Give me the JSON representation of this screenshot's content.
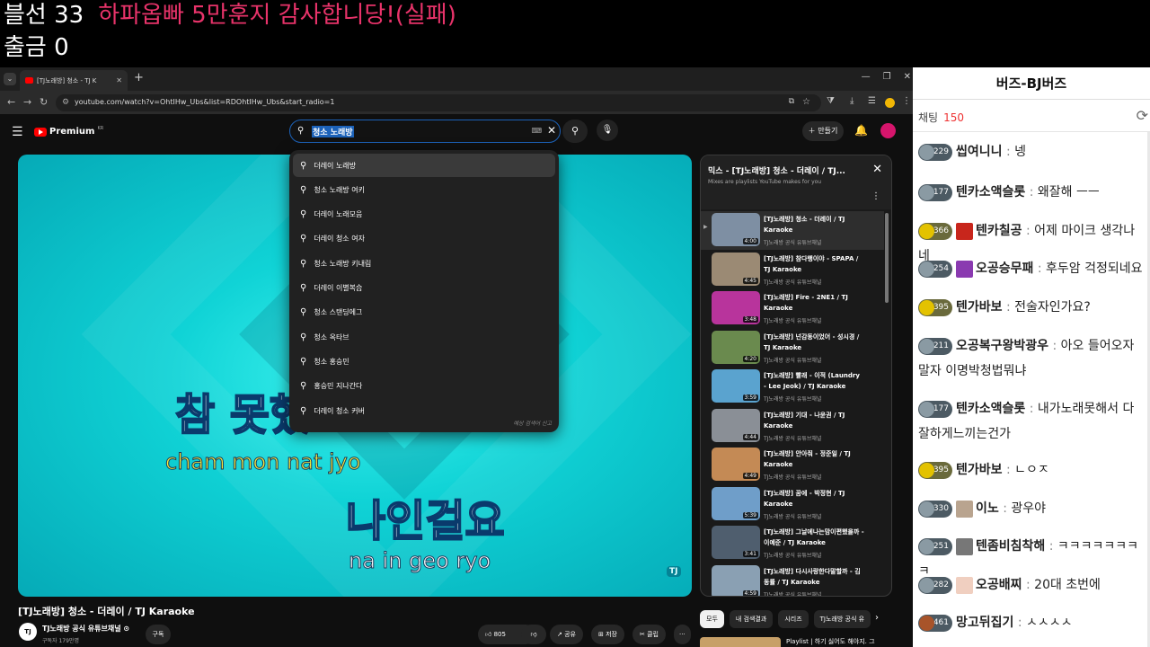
{
  "overlay": {
    "balloon": "블선 33",
    "thanks": "하파옵빠 5만훈지 감사합니당!(실패)",
    "withdraw": "출금 0"
  },
  "browser": {
    "tab_title": "[TJ노래방] 청소 - TJ K",
    "url": "youtube.com/watch?v=OhtIHw_Ubs&list=RDOhtIHw_Ubs&start_radio=1"
  },
  "youtube": {
    "logo_text": "Premium",
    "logo_region": "KR",
    "search_query": "청소 노래방",
    "create_label": "만들기",
    "suggestions": [
      "더레이 노래방",
      "청소 노래방 여키",
      "더레이 노래모음",
      "더레이 청소 여자",
      "청소 노래방 키내림",
      "더레이 이별복습",
      "청소 스탠딩에그",
      "청소 옥타브",
      "청소 홍승민",
      "홍승민 지나간다",
      "더레이 청소 커버"
    ],
    "suggest_report": "예상 검색어 신고"
  },
  "video": {
    "lyric1": "참 못했",
    "lyric1_roman": "cham  mon nat jyo",
    "lyric2": "나인걸요",
    "lyric2_roman": "na in geo ryo",
    "watermark": "TJ",
    "title": "[TJ노래방] 청소 - 더레이 / TJ Karaoke",
    "channel_logo": "TJ",
    "channel": "TJ노래방 공식 유튜브채널 ⊙",
    "subscribers": "구독자 179만명",
    "subscribe": "구독",
    "likes": "805",
    "share": "공유",
    "save": "저장",
    "clip": "클립",
    "more": "···"
  },
  "playlist": {
    "title": "믹스 - [TJ노래방] 청소 - 더레이 / TJ...",
    "subtitle": "Mixes are playlists YouTube makes for you",
    "items": [
      {
        "title": "[TJ노래방] 청소 - 더레이 / TJ Karaoke",
        "channel": "TJ노래방 공식 유튜브채널",
        "duration": "4:00",
        "color": "#7e8fa3"
      },
      {
        "title": "[TJ노래방] 참다행이야 - SPAPA / TJ Karaoke",
        "channel": "TJ노래방 공식 유튜브채널",
        "duration": "4:45",
        "color": "#9b8a74"
      },
      {
        "title": "[TJ노래방] Fire - 2NE1 / TJ Karaoke",
        "channel": "TJ노래방 공식 유튜브채널",
        "duration": "3:48",
        "color": "#b8349c"
      },
      {
        "title": "[TJ노래방] 넌감동이었어 - 성시경 / TJ Karaoke",
        "channel": "TJ노래방 공식 유튜브채널",
        "duration": "4:20",
        "color": "#6a8a4e"
      },
      {
        "title": "[TJ노래방] 빨래 - 이적 (Laundry - Lee Jeok) / TJ Karaoke",
        "channel": "TJ노래방 공식 유튜브채널",
        "duration": "3:59",
        "color": "#5aa3cf"
      },
      {
        "title": "[TJ노래방] 기대 - 나윤권 / TJ Karaoke",
        "channel": "TJ노래방 공식 유튜브채널",
        "duration": "4:44",
        "color": "#8a8f96"
      },
      {
        "title": "[TJ노래방] 안아줘 - 정준일 / TJ Karaoke",
        "channel": "TJ노래방 공식 유튜브채널",
        "duration": "4:49",
        "color": "#c48a55"
      },
      {
        "title": "[TJ노래방] 꿈에 - 박정현 / TJ Karaoke",
        "channel": "TJ노래방 공식 유튜브채널",
        "duration": "5:39",
        "color": "#6f9ec9"
      },
      {
        "title": "[TJ노래방] 그날에나는맘이편했을까 - 이예준 / TJ Karaoke",
        "channel": "TJ노래방 공식 유튜브채널",
        "duration": "3:41",
        "color": "#4f5e6e"
      },
      {
        "title": "[TJ노래방] 다시사랑한다말할까 - 김동률 / TJ Karaoke",
        "channel": "TJ노래방 공식 유튜브채널",
        "duration": "4:59",
        "color": "#8aa0b3"
      }
    ]
  },
  "chips": [
    "모두",
    "내 검색결과",
    "시리즈",
    "TJ노래방 공식 유"
  ],
  "recommend": "Playlist | 하기 싫어도 해야지. 그",
  "chat": {
    "title": "버즈-BJ버즈",
    "label": "채팅",
    "count": "150",
    "messages": [
      {
        "level": "229",
        "nick": "씹여니니",
        "text": "넹",
        "badge": "silver",
        "pfp": ""
      },
      {
        "level": "177",
        "nick": "텐카소액슬롯",
        "text": "왜잘해 ㅡㅡ",
        "badge": "silver",
        "pfp": ""
      },
      {
        "level": "366",
        "nick": "텐카칠공",
        "text": "어제 마이크 생각나네",
        "badge": "gold",
        "pfp": "#c8261c"
      },
      {
        "level": "254",
        "nick": "오공승무패",
        "text": "후두암 걱정되네요",
        "badge": "silver",
        "pfp": "#8a3ab0"
      },
      {
        "level": "395",
        "nick": "텐가바보",
        "text": "전술자인가요?",
        "badge": "gold",
        "pfp": ""
      },
      {
        "level": "211",
        "nick": "오공복구왕박광우",
        "text": "아오 들어오자말자 이명박청법뭐냐",
        "badge": "silver",
        "pfp": ""
      },
      {
        "level": "177",
        "nick": "텐카소액슬롯",
        "text": "내가노래못해서 다잘하게느끼는건가",
        "badge": "silver",
        "pfp": ""
      },
      {
        "level": "395",
        "nick": "텐가바보",
        "text": "ㄴㅇㅈ",
        "badge": "gold",
        "pfp": ""
      },
      {
        "level": "330",
        "nick": "이노",
        "text": "광우야",
        "badge": "silver",
        "pfp": "#b9a48f"
      },
      {
        "level": "251",
        "nick": "텐좀비침착해",
        "text": "ㅋㅋㅋㅋㅋㅋㅋㅋ",
        "badge": "silver",
        "pfp": "#777777"
      },
      {
        "level": "282",
        "nick": "오공배찌",
        "text": "20대 초번에",
        "badge": "silver",
        "pfp": "#f0cfc0"
      },
      {
        "level": "461",
        "nick": "망고뒤집기",
        "text": "ㅅㅅㅅㅅ",
        "badge": "bronze",
        "pfp": ""
      }
    ]
  }
}
